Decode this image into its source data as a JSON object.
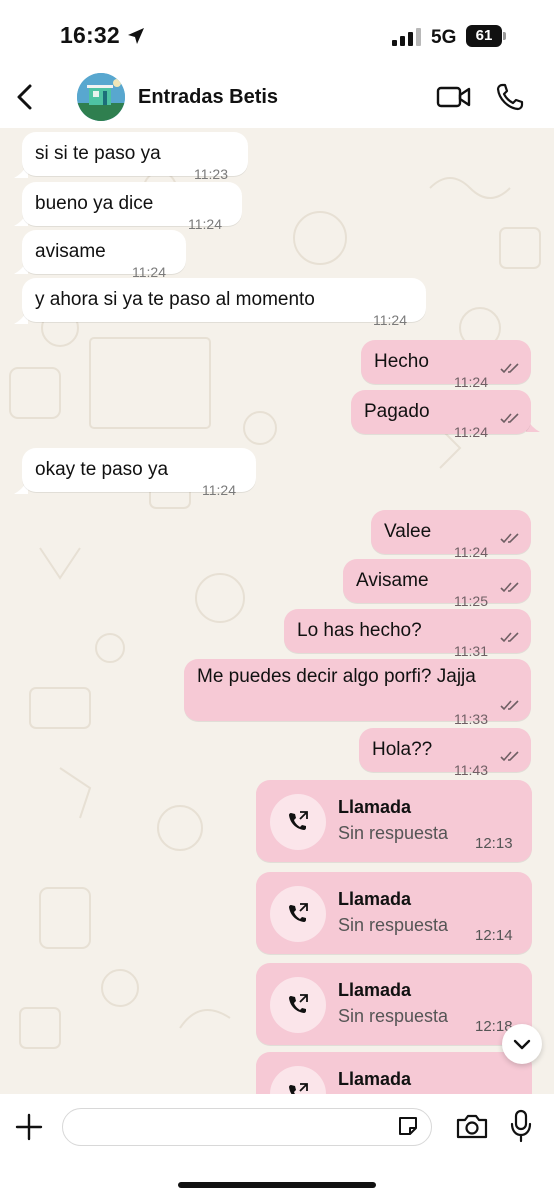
{
  "status_bar": {
    "time": "16:32",
    "network": "5G",
    "battery": "61"
  },
  "header": {
    "title": "Entradas Betis"
  },
  "messages": [
    {
      "dir": "in",
      "text": "si si te paso ya",
      "time": "11:23"
    },
    {
      "dir": "in",
      "text": "bueno ya dice",
      "time": "11:24"
    },
    {
      "dir": "in",
      "text": "avisame",
      "time": "11:24"
    },
    {
      "dir": "in",
      "text": "y ahora si ya te paso al momento",
      "time": "11:24"
    },
    {
      "dir": "out",
      "text": "Hecho",
      "time": "11:24"
    },
    {
      "dir": "out",
      "text": "Pagado",
      "time": "11:24"
    },
    {
      "dir": "in",
      "text": "okay te paso ya",
      "time": "11:24"
    },
    {
      "dir": "out",
      "text": "Valee",
      "time": "11:24"
    },
    {
      "dir": "out",
      "text": "Avisame",
      "time": "11:25"
    },
    {
      "dir": "out",
      "text": "Lo has hecho?",
      "time": "11:31"
    },
    {
      "dir": "out",
      "text": "Me puedes decir algo porfi? Jajja",
      "time": "11:33"
    },
    {
      "dir": "out",
      "text": "Hola??",
      "time": "11:43"
    }
  ],
  "calls": [
    {
      "label": "Llamada",
      "status": "Sin respuesta",
      "time": "12:13"
    },
    {
      "label": "Llamada",
      "status": "Sin respuesta",
      "time": "12:14"
    },
    {
      "label": "Llamada",
      "status": "Sin respuesta",
      "time": "12:18"
    },
    {
      "label": "Llamada"
    }
  ],
  "input": {
    "placeholder": ""
  },
  "colors": {
    "outgoing_bubble": "#f6c9d5",
    "incoming_bubble": "#ffffff",
    "wallpaper": "#f5f1ea"
  },
  "icons": [
    "back-icon",
    "video-call-icon",
    "phone-icon",
    "missed-call-icon",
    "chevron-down-icon",
    "plus-icon",
    "sticker-icon",
    "camera-icon",
    "mic-icon",
    "location-arrow-icon",
    "signal-icon",
    "battery-icon"
  ]
}
